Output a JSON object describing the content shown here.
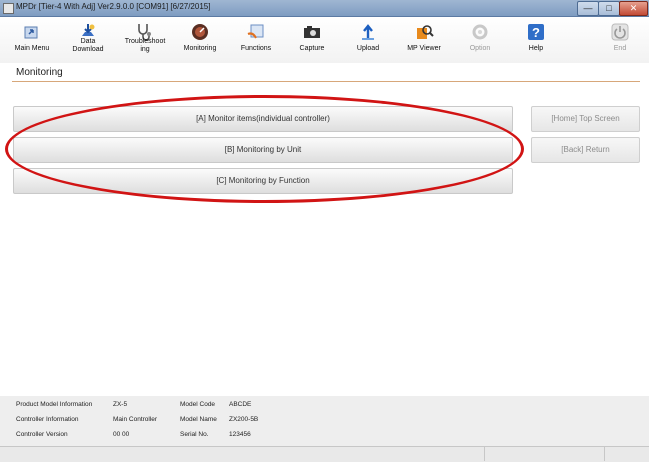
{
  "window": {
    "title": "MPDr [Tier-4 With Adj] Ver2.9.0.0 [COM91] [6/27/2015]",
    "min_label": "—",
    "max_label": "□",
    "close_label": "✕"
  },
  "toolbar": {
    "items": [
      {
        "label": "Main Menu",
        "icon": "main-menu-icon"
      },
      {
        "label": "Data\nDownload",
        "icon": "download-icon"
      },
      {
        "label": "Troubleshoot\ning",
        "icon": "stethoscope-icon"
      },
      {
        "label": "Monitoring",
        "icon": "monitoring-icon"
      },
      {
        "label": "Functions",
        "icon": "functions-icon"
      },
      {
        "label": "Capture",
        "icon": "camera-icon"
      },
      {
        "label": "Upload",
        "icon": "upload-icon"
      },
      {
        "label": "MP Viewer",
        "icon": "viewer-icon"
      },
      {
        "label": "Option",
        "icon": "option-icon",
        "disabled": true
      },
      {
        "label": "Help",
        "icon": "help-icon"
      },
      {
        "label": "End",
        "icon": "power-icon",
        "disabled": true
      }
    ]
  },
  "section": {
    "title": "Monitoring"
  },
  "main_buttons": [
    {
      "label": "[A] Monitor items(individual controller)"
    },
    {
      "label": "[B] Monitoring by Unit"
    },
    {
      "label": "[C] Monitoring by Function"
    }
  ],
  "side_buttons": [
    {
      "label": "[Home] Top Screen"
    },
    {
      "label": "[Back] Return"
    }
  ],
  "info": {
    "product_model_label": "Product Model Information",
    "product_model_value": "ZX-5",
    "controller_info_label": "Controller Information",
    "controller_info_value": "Main Controller",
    "controller_version_label": "Controller Version",
    "controller_version_value": "00 00",
    "model_code_label": "Model Code",
    "model_code_value": "ABCDE",
    "model_name_label": "Model Name",
    "model_name_value": "ZX200-5B",
    "serial_no_label": "Serial No.",
    "serial_no_value": "123456"
  },
  "colors": {
    "highlight_oval": "#d11414",
    "section_underline": "#d7a77a"
  }
}
